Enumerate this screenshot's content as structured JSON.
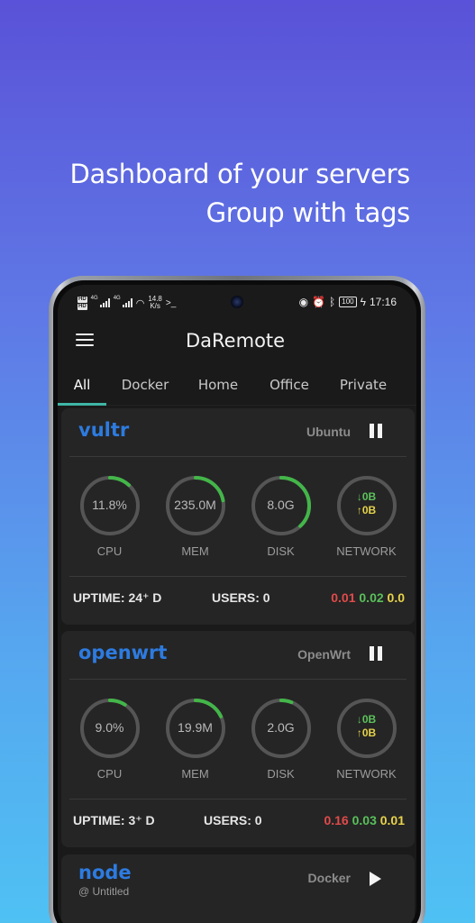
{
  "headline": {
    "line1": "Dashboard of your servers",
    "line2": "Group with tags"
  },
  "status_bar": {
    "speed_value": "14.8",
    "speed_unit": "K/s",
    "battery": "100",
    "time": "17:16",
    "sig_a": "4G",
    "sig_b": "4G"
  },
  "app": {
    "title": "DaRemote"
  },
  "tabs": [
    {
      "label": "All",
      "active": true
    },
    {
      "label": "Docker",
      "active": false
    },
    {
      "label": "Home",
      "active": false
    },
    {
      "label": "Office",
      "active": false
    },
    {
      "label": "Private",
      "active": false
    }
  ],
  "servers": [
    {
      "name": "vultr",
      "os": "Ubuntu",
      "state": "pause",
      "cpu": {
        "text": "11.8%",
        "fraction": 0.118
      },
      "mem": {
        "text": "235.0M",
        "fraction": 0.22
      },
      "disk": {
        "text": "8.0G",
        "fraction": 0.38
      },
      "network": {
        "down": "↓0B",
        "up": "↑0B"
      },
      "labels": {
        "cpu": "CPU",
        "mem": "MEM",
        "disk": "DISK",
        "network": "NETWORK"
      },
      "uptime": "UPTIME: 24⁺ D",
      "users": "USERS: 0",
      "load": [
        "0.01",
        "0.02",
        "0.0"
      ]
    },
    {
      "name": "openwrt",
      "os": "OpenWrt",
      "state": "pause",
      "cpu": {
        "text": "9.0%",
        "fraction": 0.09
      },
      "mem": {
        "text": "19.9M",
        "fraction": 0.18
      },
      "disk": {
        "text": "2.0G",
        "fraction": 0.06
      },
      "network": {
        "down": "↓0B",
        "up": "↑0B"
      },
      "labels": {
        "cpu": "CPU",
        "mem": "MEM",
        "disk": "DISK",
        "network": "NETWORK"
      },
      "uptime": "UPTIME: 3⁺ D",
      "users": "USERS: 0",
      "load": [
        "0.16",
        "0.03",
        "0.01"
      ]
    },
    {
      "name": "node",
      "subtitle": "@ Untitled",
      "os": "Docker",
      "state": "play"
    }
  ],
  "colors": {
    "accent": "#3fb6a6",
    "gauge_fill": "#43b649",
    "gauge_track": "#555555",
    "name": "#2d7be0"
  }
}
